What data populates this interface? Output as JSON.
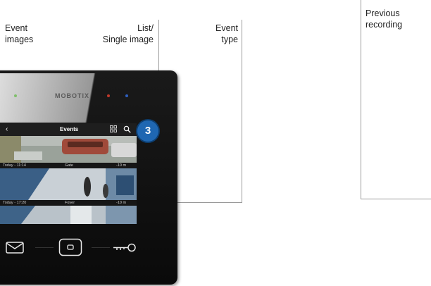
{
  "callouts": {
    "event_images": [
      "Event",
      "images"
    ],
    "list_single": [
      "List/",
      "Single image"
    ],
    "event_type": [
      "Event",
      "type"
    ],
    "previous_recording": [
      "Previous",
      "recording"
    ]
  },
  "device": {
    "brand": "MOBOTIX",
    "screen_title": "Events",
    "badge": "3",
    "events": [
      {
        "time": "Today - 11:14",
        "type": "Gate",
        "ago": "-10 m"
      },
      {
        "time": "Today - 17:20",
        "type": "Foyer",
        "ago": "-10 m"
      }
    ]
  },
  "icons": [
    "back-chevron-icon",
    "grid-view-icon",
    "search-icon",
    "mail-icon",
    "home-button-icon",
    "key-icon"
  ],
  "colors": {
    "badge": "#1f67b2",
    "device": "#111111",
    "line": "#9a9a9a"
  }
}
